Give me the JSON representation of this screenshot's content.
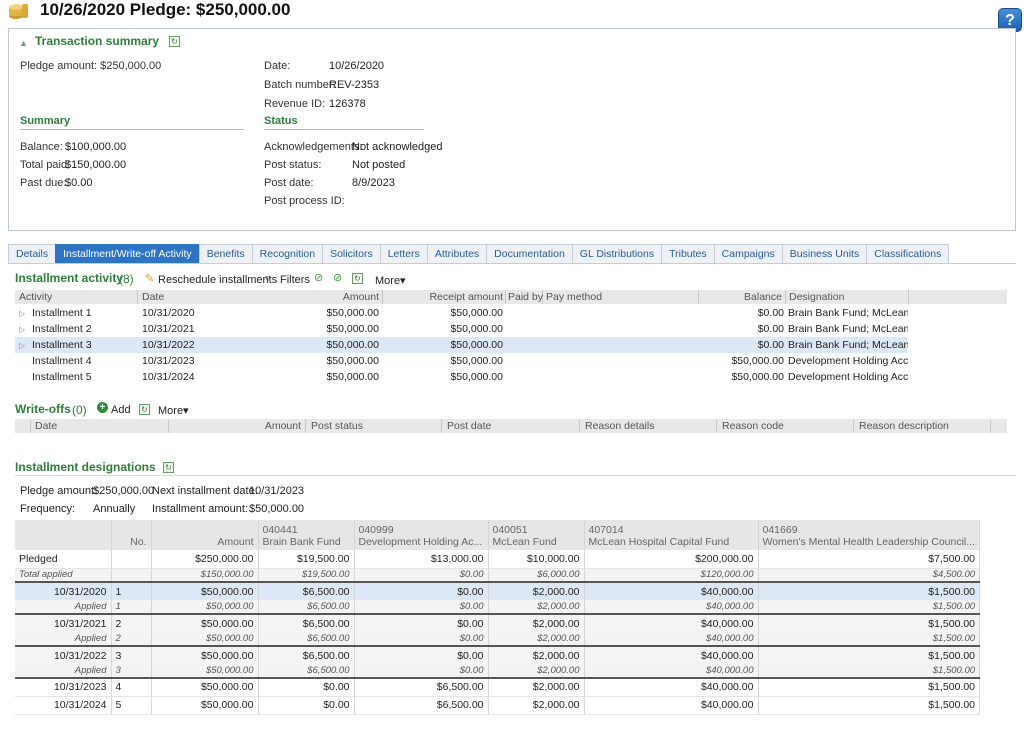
{
  "page": {
    "title": "10/26/2020 Pledge: $250,000.00"
  },
  "summary_box": {
    "header": "Transaction summary",
    "pledge_amount": "Pledge amount: $250,000.00",
    "date_label": "Date:",
    "date_value": "10/26/2020",
    "batch_label": "Batch number:",
    "batch_value": "REV-2353",
    "revenue_label": "Revenue ID:",
    "revenue_value": "126378",
    "summary_head": "Summary",
    "balance_label": "Balance:",
    "balance_value": "$100,000.00",
    "total_paid_label": "Total paid:",
    "total_paid_value": "$150,000.00",
    "past_due_label": "Past due:",
    "past_due_value": "$0.00",
    "status_head": "Status",
    "ack_label": "Acknowledgements:",
    "ack_value": "Not acknowledged",
    "post_status_label": "Post status:",
    "post_status_value": "Not posted",
    "post_date_label": "Post date:",
    "post_date_value": "8/9/2023",
    "post_process_label": "Post process ID:"
  },
  "tabs": [
    "Details",
    "Installment/Write-off Activity",
    "Benefits",
    "Recognition",
    "Solicitors",
    "Letters",
    "Attributes",
    "Documentation",
    "GL Distributions",
    "Tributes",
    "Campaigns",
    "Business Units",
    "Classifications"
  ],
  "installment_activity": {
    "title": "Installment activity",
    "count": "(8)",
    "reschedule": "Reschedule installments",
    "filters": "Filters",
    "more": "More▾",
    "columns": [
      "Activity",
      "Date",
      "Amount",
      "Receipt amount",
      "Paid by",
      "Pay method",
      "Balance",
      "Designation"
    ],
    "rows": [
      {
        "activity": "Installment 1",
        "date": "10/31/2020",
        "amount": "$50,000.00",
        "receipt": "$50,000.00",
        "balance": "$0.00",
        "designation": "Brain Bank Fund; McLean ..."
      },
      {
        "activity": "Installment 2",
        "date": "10/31/2021",
        "amount": "$50,000.00",
        "receipt": "$50,000.00",
        "balance": "$0.00",
        "designation": "Brain Bank Fund; McLean ..."
      },
      {
        "activity": "Installment 3",
        "date": "10/31/2022",
        "amount": "$50,000.00",
        "receipt": "$50,000.00",
        "balance": "$0.00",
        "designation": "Brain Bank Fund; McLean ..."
      },
      {
        "activity": "Installment 4",
        "date": "10/31/2023",
        "amount": "$50,000.00",
        "receipt": "$50,000.00",
        "balance": "$50,000.00",
        "designation": "Development Holding Acc..."
      },
      {
        "activity": "Installment 5",
        "date": "10/31/2024",
        "amount": "$50,000.00",
        "receipt": "$50,000.00",
        "balance": "$50,000.00",
        "designation": "Development Holding Acc..."
      }
    ]
  },
  "writeoffs": {
    "title": "Write-offs",
    "count": "(0)",
    "add": "Add",
    "more": "More▾",
    "columns": [
      "Date",
      "Amount",
      "Post status",
      "Post date",
      "Reason details",
      "Reason code",
      "Reason description"
    ]
  },
  "designations": {
    "title": "Installment designations",
    "pledge_amount_label": "Pledge amount:",
    "pledge_amount_value": "$250,000.00",
    "next_date_label": "Next installment date:",
    "next_date_value": "10/31/2023",
    "frequency_label": "Frequency:",
    "frequency_value": "Annually",
    "inst_amount_label": "Installment amount:",
    "inst_amount_value": "$50,000.00",
    "columns": [
      {
        "code": "",
        "name": ""
      },
      {
        "code": "",
        "name": "No."
      },
      {
        "code": "",
        "name": "Amount"
      },
      {
        "code": "040441",
        "name": "Brain Bank Fund"
      },
      {
        "code": "040999",
        "name": "Development Holding Ac..."
      },
      {
        "code": "040051",
        "name": "McLean Fund"
      },
      {
        "code": "407014",
        "name": "McLean Hospital Capital Fund"
      },
      {
        "code": "041669",
        "name": "Women's Mental Health Leadership Council..."
      }
    ],
    "rows": [
      {
        "type": "plain",
        "cells": [
          "Pledged",
          "",
          "$250,000.00",
          "$19,500.00",
          "$13,000.00",
          "$10,000.00",
          "$200,000.00",
          "$7,500.00"
        ]
      },
      {
        "type": "italic applied",
        "cells": [
          "Total applied",
          "",
          "$150,000.00",
          "$19,500.00",
          "$0.00",
          "$6,000.00",
          "$120,000.00",
          "$4,500.00"
        ]
      },
      {
        "type": "sel",
        "cells": [
          "10/31/2020",
          "1",
          "$50,000.00",
          "$6,500.00",
          "$0.00",
          "$2,000.00",
          "$40,000.00",
          "$1,500.00"
        ]
      },
      {
        "type": "italic applied",
        "cells": [
          "Applied",
          "1",
          "$50,000.00",
          "$6,500.00",
          "$0.00",
          "$2,000.00",
          "$40,000.00",
          "$1,500.00"
        ]
      },
      {
        "type": "inst",
        "cells": [
          "10/31/2021",
          "2",
          "$50,000.00",
          "$6,500.00",
          "$0.00",
          "$2,000.00",
          "$40,000.00",
          "$1,500.00"
        ]
      },
      {
        "type": "italic applied",
        "cells": [
          "Applied",
          "2",
          "$50,000.00",
          "$6,500.00",
          "$0.00",
          "$2,000.00",
          "$40,000.00",
          "$1,500.00"
        ]
      },
      {
        "type": "inst",
        "cells": [
          "10/31/2022",
          "3",
          "$50,000.00",
          "$6,500.00",
          "$0.00",
          "$2,000.00",
          "$40,000.00",
          "$1,500.00"
        ]
      },
      {
        "type": "italic applied",
        "cells": [
          "Applied",
          "3",
          "$50,000.00",
          "$6,500.00",
          "$0.00",
          "$2,000.00",
          "$40,000.00",
          "$1,500.00"
        ]
      },
      {
        "type": "plain",
        "cells": [
          "10/31/2023",
          "4",
          "$50,000.00",
          "$0.00",
          "$6,500.00",
          "$2,000.00",
          "$40,000.00",
          "$1,500.00"
        ]
      },
      {
        "type": "plain",
        "cells": [
          "10/31/2024",
          "5",
          "$50,000.00",
          "$0.00",
          "$6,500.00",
          "$2,000.00",
          "$40,000.00",
          "$1,500.00"
        ]
      }
    ]
  }
}
